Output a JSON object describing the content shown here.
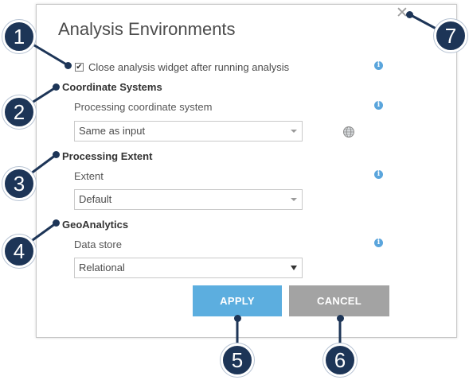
{
  "dialog": {
    "title": "Analysis Environments",
    "close_icon": "close-icon",
    "close_widget": {
      "label": "Close analysis widget after running analysis",
      "checked": true
    },
    "coordinate_systems": {
      "heading": "Coordinate Systems",
      "field_label": "Processing coordinate system",
      "value": "Same as input"
    },
    "processing_extent": {
      "heading": "Processing Extent",
      "field_label": "Extent",
      "value": "Default"
    },
    "geoanalytics": {
      "heading": "GeoAnalytics",
      "field_label": "Data store",
      "value": "Relational"
    },
    "buttons": {
      "apply": "APPLY",
      "cancel": "CANCEL"
    }
  },
  "callouts": [
    "1",
    "2",
    "3",
    "4",
    "5",
    "6",
    "7"
  ],
  "colors": {
    "callout": "#1d3557",
    "apply": "#5caedf",
    "cancel": "#a3a3a3",
    "info": "#5aa5dc"
  },
  "icons": {
    "info": "info-icon",
    "globe": "globe-icon",
    "checkbox": "checkbox-checked-icon",
    "caret": "chevron-down-icon"
  }
}
